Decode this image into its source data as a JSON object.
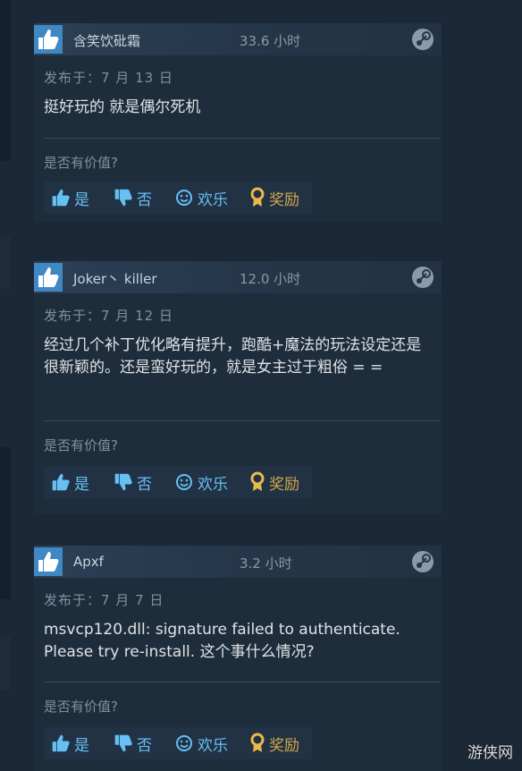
{
  "reviews": [
    {
      "author": "含笑饮砒霜",
      "hours": "33.6 小时",
      "date": "发布于：7 月 13 日",
      "text": "挺好玩的 就是偶尔死机",
      "helpful_question": "是否有价值?",
      "actions": {
        "yes": "是",
        "no": "否",
        "funny": "欢乐",
        "award": "奖励"
      }
    },
    {
      "author": "Joker丶 killer",
      "hours": "12.0 小时",
      "date": "发布于：7 月 12 日",
      "text": "经过几个补丁优化略有提升，跑酷+魔法的玩法设定还是很新颖的。还是蛮好玩的，就是女主过于粗俗 = =",
      "helpful_question": "是否有价值?",
      "actions": {
        "yes": "是",
        "no": "否",
        "funny": "欢乐",
        "award": "奖励"
      }
    },
    {
      "author": "Apxf",
      "hours": "3.2 小时",
      "date": "发布于：7 月 7 日",
      "text": "msvcp120.dll: signature failed to authenticate. Please try re-install. 这个事什么情况?",
      "helpful_question": "是否有价值?",
      "actions": {
        "yes": "是",
        "no": "否",
        "funny": "欢乐",
        "award": "奖励"
      }
    }
  ],
  "watermark": "游侠网",
  "colors": {
    "background": "#1b2838",
    "link": "#66c0f4",
    "award": "#d2a64c",
    "avatar": "#3f88c4"
  },
  "icons": [
    "recommended-thumbs-up-icon",
    "steam-logo-icon",
    "thumbs-up-icon",
    "thumbs-down-icon",
    "smiley-icon",
    "award-icon"
  ]
}
